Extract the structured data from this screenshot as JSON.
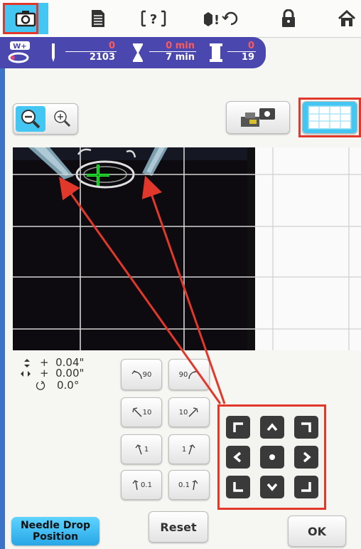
{
  "tabs": [
    {
      "icon": "camera-icon"
    },
    {
      "icon": "document-icon"
    },
    {
      "icon": "help-icon",
      "label": "?"
    },
    {
      "icon": "maintenance-icon",
      "label": "!"
    },
    {
      "icon": "lock-icon"
    },
    {
      "icon": "home-icon"
    }
  ],
  "status": {
    "presser_foot": "W+",
    "stitch_current": "0",
    "stitch_total": "2103",
    "time_current": "0 min",
    "time_total": "7 min",
    "color_current": "0",
    "color_total": "19"
  },
  "readouts": {
    "vertical": "+  0.04\"",
    "horizontal": "+  0.00\"",
    "angle": "0.0°"
  },
  "rotation_buttons": {
    "ccw_90": "90",
    "cw_90": "90",
    "ccw_10": "10",
    "cw_10": "10",
    "ccw_1": "1",
    "cw_1": "1",
    "ccw_01": "0.1",
    "cw_01": "0.1"
  },
  "buttons": {
    "needle_drop_line1": "Needle Drop",
    "needle_drop_line2": "Position",
    "reset": "Reset",
    "ok": "OK"
  },
  "colors": {
    "accent": "#43c7f2",
    "status_bar": "#4a48ae",
    "highlight": "#e1382b",
    "crosshair": "#2bff3a"
  }
}
